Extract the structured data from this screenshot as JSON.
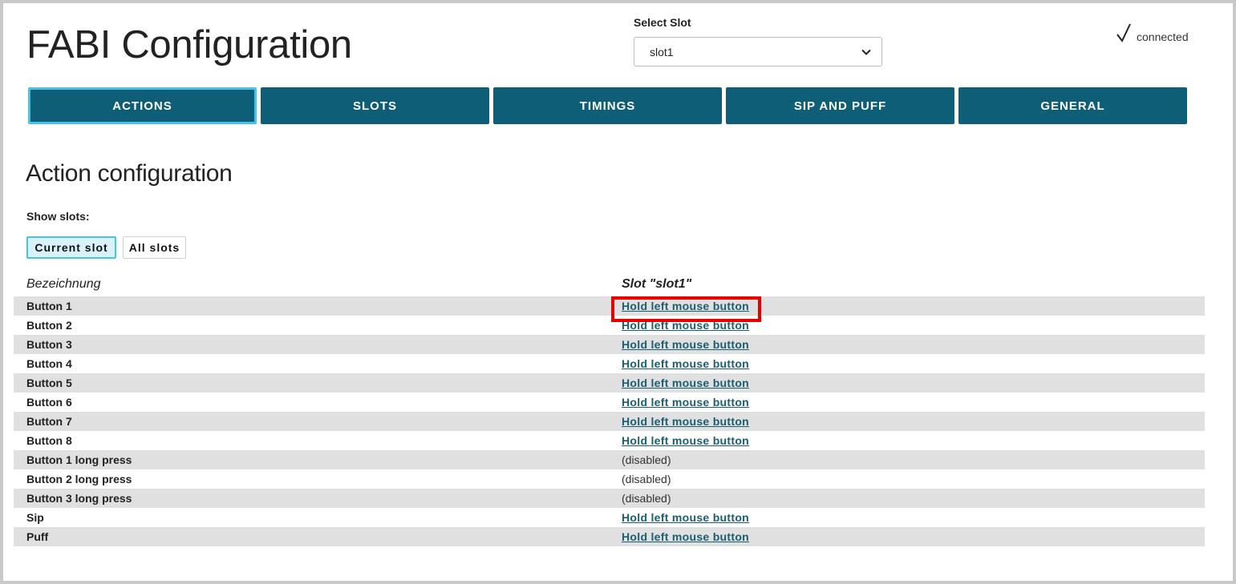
{
  "header": {
    "title": "FABI Configuration",
    "select_slot_label": "Select Slot",
    "selected_slot": "slot1",
    "status_text": "connected"
  },
  "tabs": [
    {
      "label": "ACTIONS",
      "active": true
    },
    {
      "label": "SLOTS",
      "active": false
    },
    {
      "label": "TIMINGS",
      "active": false
    },
    {
      "label": "SIP AND PUFF",
      "active": false
    },
    {
      "label": "GENERAL",
      "active": false
    }
  ],
  "main": {
    "section_title": "Action configuration",
    "show_slots_label": "Show slots:",
    "show_slots_options": [
      "Current slot",
      "All slots"
    ],
    "selected_option": "Current slot",
    "table": {
      "columns": [
        "Bezeichnung",
        "Slot \"slot1\""
      ],
      "rows": [
        {
          "name": "Button 1",
          "action": "Hold left mouse button"
        },
        {
          "name": "Button 2",
          "action": "Hold left mouse button"
        },
        {
          "name": "Button 3",
          "action": "Hold left mouse button"
        },
        {
          "name": "Button 4",
          "action": "Hold left mouse button"
        },
        {
          "name": "Button 5",
          "action": "Hold left mouse button"
        },
        {
          "name": "Button 6",
          "action": "Hold left mouse button"
        },
        {
          "name": "Button 7",
          "action": "Hold left mouse button"
        },
        {
          "name": "Button 8",
          "action": "Hold left mouse button"
        },
        {
          "name": "Button 1 long press",
          "action": "(disabled)"
        },
        {
          "name": "Button 2 long press",
          "action": "(disabled)"
        },
        {
          "name": "Button 3 long press",
          "action": "(disabled)"
        },
        {
          "name": "Sip",
          "action": "Hold left mouse button"
        },
        {
          "name": "Puff",
          "action": "Hold left mouse button"
        }
      ]
    }
  },
  "colors": {
    "tab_bg": "#0f5e78",
    "tab_active_border": "#46c3ea",
    "link": "#1a5e72",
    "row_shade": "#e0e0e0",
    "highlight": "#e60000"
  },
  "icons": {
    "status": "check-icon",
    "select": "chevron-down-icon"
  }
}
